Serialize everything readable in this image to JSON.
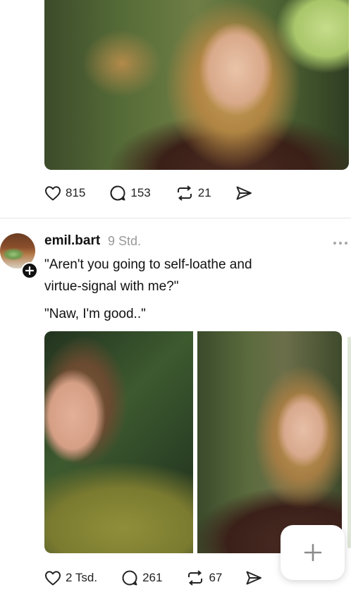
{
  "post1": {
    "image_alt": "",
    "actions": {
      "likes": "815",
      "replies": "153",
      "reposts": "21"
    }
  },
  "post2": {
    "username": "emil.bart",
    "timestamp": "9 Std.",
    "text_line1": "\"Aren't you going to self-loathe and",
    "text_line2": "virtue-signal with me?\"",
    "text_line3": "\"Naw, I'm good..\"",
    "actions": {
      "likes": "2 Tsd.",
      "replies": "261",
      "reposts": "67"
    }
  },
  "icons": {
    "like": "heart-icon",
    "reply": "comment-icon",
    "repost": "repost-icon",
    "share": "send-icon",
    "more": "more-icon",
    "follow": "plus-icon",
    "compose": "plus-icon"
  }
}
